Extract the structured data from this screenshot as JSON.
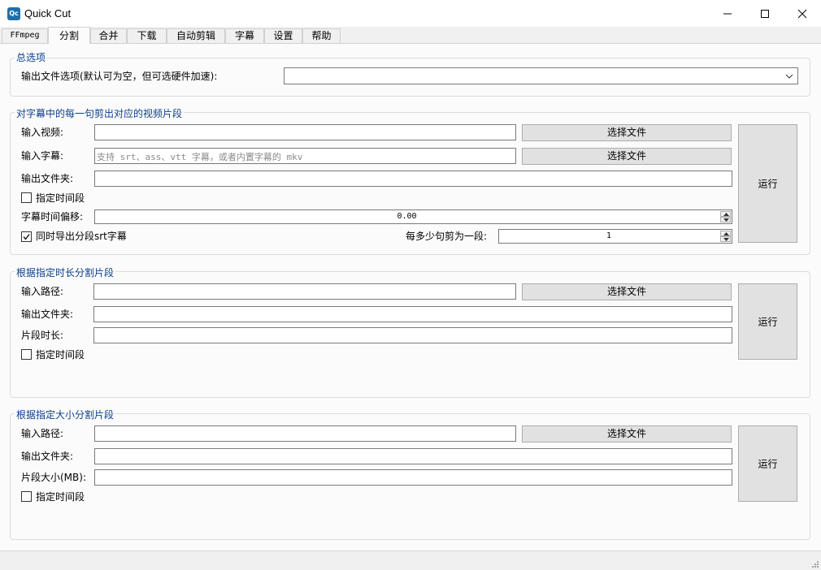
{
  "window": {
    "icon_text": "Qc",
    "title": "Quick Cut"
  },
  "tabs": [
    {
      "label": "FFmpeg",
      "active": false
    },
    {
      "label": "分割",
      "active": true
    },
    {
      "label": "合并",
      "active": false
    },
    {
      "label": "下载",
      "active": false
    },
    {
      "label": "自动剪辑",
      "active": false
    },
    {
      "label": "字幕",
      "active": false
    },
    {
      "label": "设置",
      "active": false
    },
    {
      "label": "帮助",
      "active": false
    }
  ],
  "general": {
    "title": "总选项",
    "output_options_label": "输出文件选项(默认可为空，但可选硬件加速):",
    "output_options_value": ""
  },
  "subtitle_split": {
    "title": "对字幕中的每一句剪出对应的视频片段",
    "input_video_label": "输入视频:",
    "input_video_value": "",
    "input_subtitle_label": "输入字幕:",
    "input_subtitle_placeholder": "支持 srt、ass、vtt 字幕，或者内置字幕的 mkv",
    "output_folder_label": "输出文件夹:",
    "output_folder_value": "",
    "choose_file_label": "选择文件",
    "specify_time_label": "指定时间段",
    "specify_time_checked": false,
    "offset_label": "字幕时间偏移:",
    "offset_value": "0.00",
    "export_srt_label": "同时导出分段srt字幕",
    "export_srt_checked": true,
    "per_segment_label": "每多少句剪为一段:",
    "per_segment_value": "1",
    "run_label": "运行"
  },
  "duration_split": {
    "title": "根据指定时长分割片段",
    "input_path_label": "输入路径:",
    "input_path_value": "",
    "output_folder_label": "输出文件夹:",
    "output_folder_value": "",
    "segment_duration_label": "片段时长:",
    "segment_duration_value": "",
    "choose_file_label": "选择文件",
    "specify_time_label": "指定时间段",
    "specify_time_checked": false,
    "run_label": "运行"
  },
  "size_split": {
    "title": "根据指定大小分割片段",
    "input_path_label": "输入路径:",
    "input_path_value": "",
    "output_folder_label": "输出文件夹:",
    "output_folder_value": "",
    "segment_size_label": "片段大小(MB):",
    "segment_size_value": "",
    "choose_file_label": "选择文件",
    "specify_time_label": "指定时间段",
    "specify_time_checked": false,
    "run_label": "运行"
  }
}
